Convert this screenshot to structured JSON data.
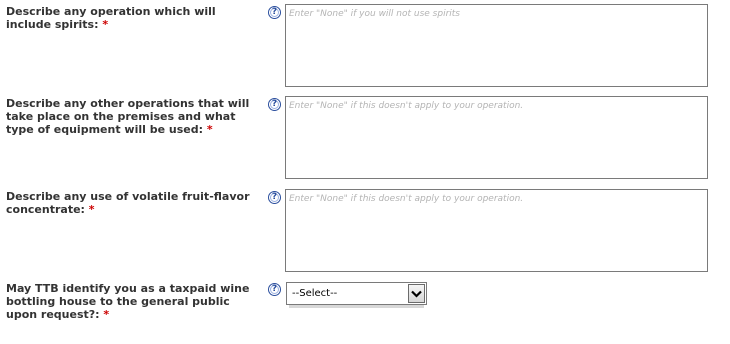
{
  "form": {
    "required_marker": "*",
    "help_glyph": "?",
    "fields": [
      {
        "label": "Describe any operation which will include spirits:",
        "placeholder": "Enter \"None\" if you will not use spirits",
        "value": ""
      },
      {
        "label": "Describe any other operations that will take place on the premises and what type of equipment will be used:",
        "placeholder": "Enter \"None\" if this doesn't apply to your operation.",
        "value": ""
      },
      {
        "label": "Describe any use of volatile fruit-flavor concentrate:",
        "placeholder": "Enter \"None\" if this doesn't apply to your operation.",
        "value": ""
      },
      {
        "label": "May TTB identify you as a taxpaid wine bottling house to the general public upon request?:",
        "selected": "--Select--"
      }
    ]
  },
  "icons": {
    "help": "help-question-icon",
    "dropdown": "chevron-down-icon"
  },
  "colors": {
    "label_text": "#333333",
    "required": "#cc0000",
    "help_icon": "#2b4f9e",
    "placeholder": "#b4b4b4",
    "border": "#7a7a7a"
  }
}
